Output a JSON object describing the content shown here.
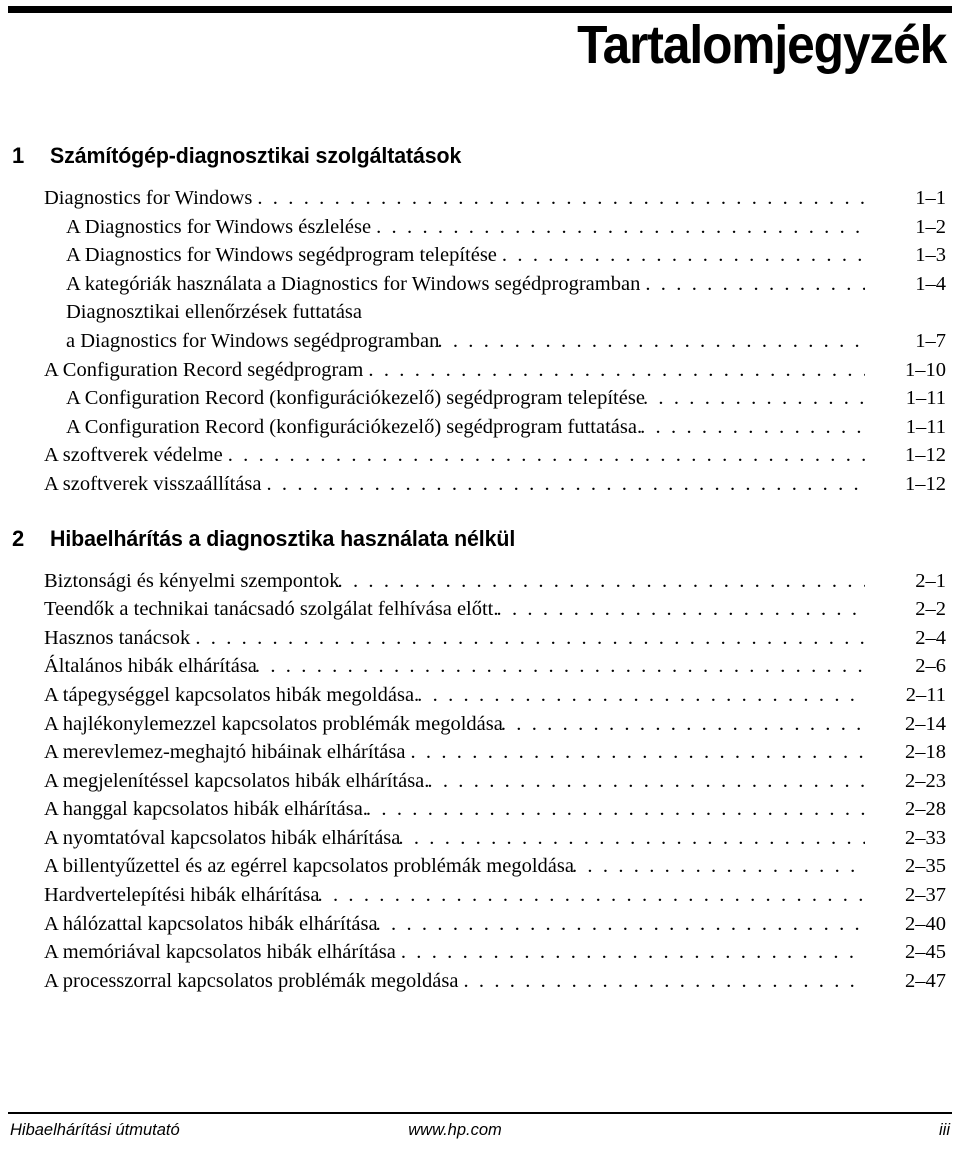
{
  "document": {
    "title": "Tartalomjegyzék"
  },
  "chapters": [
    {
      "number": "1",
      "title": "Számítógép-diagnosztikai szolgáltatások",
      "entries": [
        {
          "level": 1,
          "label": "Diagnostics for Windows",
          "page": "1–1",
          "gap": "loose"
        },
        {
          "level": 2,
          "label": "A Diagnostics for Windows észlelése",
          "page": "1–2",
          "gap": "loose"
        },
        {
          "level": 2,
          "label": "A Diagnostics for Windows segédprogram telepítése",
          "page": "1–3",
          "gap": "loose"
        },
        {
          "level": 2,
          "label": "A kategóriák használata a Diagnostics for Windows segédprogramban",
          "page": "1–4",
          "gap": "loose"
        },
        {
          "level": 2,
          "label": "Diagnosztikai ellenőrzések futtatása",
          "page": "",
          "gap": "cont"
        },
        {
          "level": 2,
          "label": "a Diagnostics for Windows segédprogramban",
          "page": "1–7",
          "gap": "tight"
        },
        {
          "level": 1,
          "label": "A Configuration Record segédprogram",
          "page": "1–10",
          "gap": "loose"
        },
        {
          "level": 2,
          "label": "A Configuration Record (konfigurációkezelő) segédprogram telepítése",
          "page": "1–11",
          "gap": "tight"
        },
        {
          "level": 2,
          "label": "A Configuration Record (konfigurációkezelő) segédprogram futtatása.",
          "page": "1–11",
          "gap": "tight"
        },
        {
          "level": 1,
          "label": "A szoftverek védelme",
          "page": "1–12",
          "gap": "loose"
        },
        {
          "level": 1,
          "label": "A szoftverek visszaállítása",
          "page": "1–12",
          "gap": "loose"
        }
      ]
    },
    {
      "number": "2",
      "title": "Hibaelhárítás a diagnosztika használata nélkül",
      "entries": [
        {
          "level": 1,
          "label": "Biztonsági és kényelmi szempontok",
          "page": "2–1",
          "gap": "tight"
        },
        {
          "level": 1,
          "label": "Teendők a technikai tanácsadó szolgálat felhívása előtt.",
          "page": "2–2",
          "gap": "tight"
        },
        {
          "level": 1,
          "label": "Hasznos tanácsok",
          "page": "2–4",
          "gap": "loose"
        },
        {
          "level": 1,
          "label": "Általános hibák elhárítása",
          "page": "2–6",
          "gap": "tight"
        },
        {
          "level": 1,
          "label": "A tápegységgel kapcsolatos hibák megoldása.",
          "page": "2–11",
          "gap": "tight"
        },
        {
          "level": 1,
          "label": "A hajlékonylemezzel kapcsolatos problémák megoldása",
          "page": "2–14",
          "gap": "tight"
        },
        {
          "level": 1,
          "label": "A merevlemez-meghajtó hibáinak elhárítása",
          "page": "2–18",
          "gap": "loose"
        },
        {
          "level": 1,
          "label": "A megjelenítéssel kapcsolatos hibák elhárítása.",
          "page": "2–23",
          "gap": "tight"
        },
        {
          "level": 1,
          "label": "A hanggal kapcsolatos hibák elhárítása.",
          "page": "2–28",
          "gap": "tight"
        },
        {
          "level": 1,
          "label": "A nyomtatóval kapcsolatos hibák elhárítása",
          "page": "2–33",
          "gap": "tight"
        },
        {
          "level": 1,
          "label": "A billentyűzettel és az egérrel kapcsolatos problémák megoldása",
          "page": "2–35",
          "gap": "tight"
        },
        {
          "level": 1,
          "label": "Hardvertelepítési hibák elhárítása",
          "page": "2–37",
          "gap": "tight"
        },
        {
          "level": 1,
          "label": "A hálózattal kapcsolatos hibák elhárítása",
          "page": "2–40",
          "gap": "tight"
        },
        {
          "level": 1,
          "label": "A memóriával kapcsolatos hibák elhárítása",
          "page": "2–45",
          "gap": "loose"
        },
        {
          "level": 1,
          "label": "A processzorral kapcsolatos problémák megoldása",
          "page": "2–47",
          "gap": "loose"
        }
      ]
    }
  ],
  "footer": {
    "left": "Hibaelhárítási útmutató",
    "center": "www.hp.com",
    "right": "iii"
  }
}
